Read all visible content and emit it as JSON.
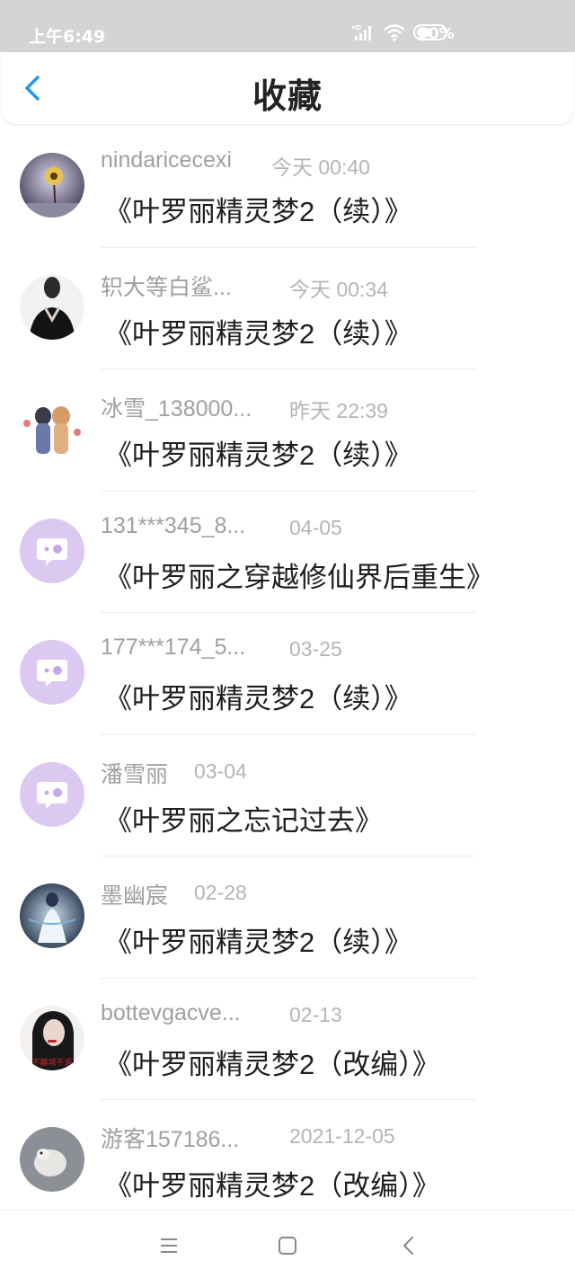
{
  "status_bar": {
    "time": "上午6:49",
    "battery": "50%"
  },
  "header": {
    "title": "收藏",
    "back_icon": "chevron-left-icon"
  },
  "colors": {
    "accent": "#2196f3",
    "placeholder_avatar": "#dcc9f2",
    "username": "#a0a0a0",
    "time": "#b5b5b5",
    "title": "#1e1e1e"
  },
  "items": [
    {
      "username": "nindaricecexi",
      "time": "今天 00:40",
      "title": "《叶罗丽精灵梦2（续）》",
      "avatar": "photo-dandelion"
    },
    {
      "username": "轵大等白鲨...",
      "time": "今天 00:34",
      "title": "《叶罗丽精灵梦2（续）》",
      "avatar": "photo-woman"
    },
    {
      "username": "冰雪_138000...",
      "time": "昨天 22:39",
      "title": "《叶罗丽精灵梦2（续）》",
      "avatar": "photo-anime-couple"
    },
    {
      "username": "131***345_8...",
      "time": "04-05",
      "title": "《叶罗丽之穿越修仙界后重生》",
      "avatar": "default-chat-avatar"
    },
    {
      "username": "177***174_5...",
      "time": "03-25",
      "title": "《叶罗丽精灵梦2（续）》",
      "avatar": "default-chat-avatar"
    },
    {
      "username": "潘雪丽",
      "time": "03-04",
      "title": "《叶罗丽之忘记过去》",
      "avatar": "default-chat-avatar"
    },
    {
      "username": "墨幽宸",
      "time": "02-28",
      "title": "《叶罗丽精灵梦2（续）》",
      "avatar": "photo-anime-blue"
    },
    {
      "username": "bottevgacve...",
      "time": "02-13",
      "title": "《叶罗丽精灵梦2（改编）》",
      "avatar": "photo-woman-red",
      "avatar_text": "不離城不遥"
    },
    {
      "username": "游客157186...",
      "time": "2021-12-05",
      "title": "《叶罗丽精灵梦2（改编）》",
      "avatar": "photo-cat"
    }
  ],
  "nav_bar": {
    "menu_icon": "menu-icon",
    "home_icon": "home-square-icon",
    "back_icon": "back-triangle-icon"
  }
}
